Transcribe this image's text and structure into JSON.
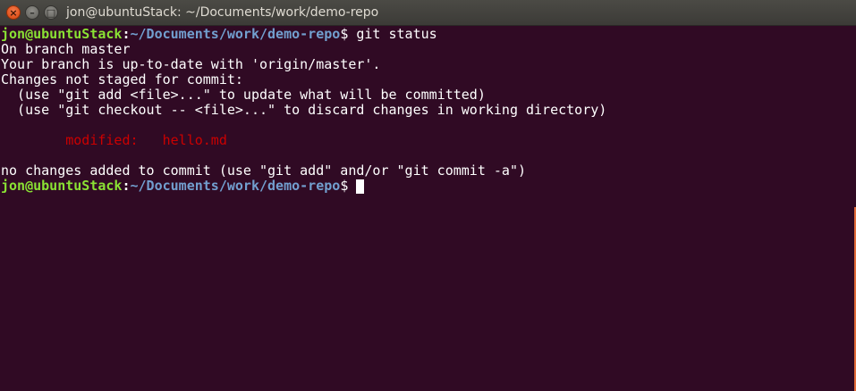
{
  "window": {
    "title": "jon@ubuntuStack: ~/Documents/work/demo-repo",
    "close_glyph": "×",
    "minimize_glyph": "–",
    "maximize_glyph": "□"
  },
  "colors": {
    "background": "#300a24",
    "prompt_user": "#8ae234",
    "prompt_path": "#729fcf",
    "modified": "#cc0000",
    "text": "#ffffff"
  },
  "terminal": {
    "prompt": {
      "user_host": "jon@ubuntuStack",
      "colon": ":",
      "path": "~/Documents/work/demo-repo",
      "sign": "$"
    },
    "command": " git status",
    "output": [
      "On branch master",
      "Your branch is up-to-date with 'origin/master'.",
      "Changes not staged for commit:",
      "  (use \"git add <file>...\" to update what will be committed)",
      "  (use \"git checkout -- <file>...\" to discard changes in working directory)"
    ],
    "modified_line": "        modified:   hello.md",
    "footer": "no changes added to commit (use \"git add\" and/or \"git commit -a\")"
  }
}
